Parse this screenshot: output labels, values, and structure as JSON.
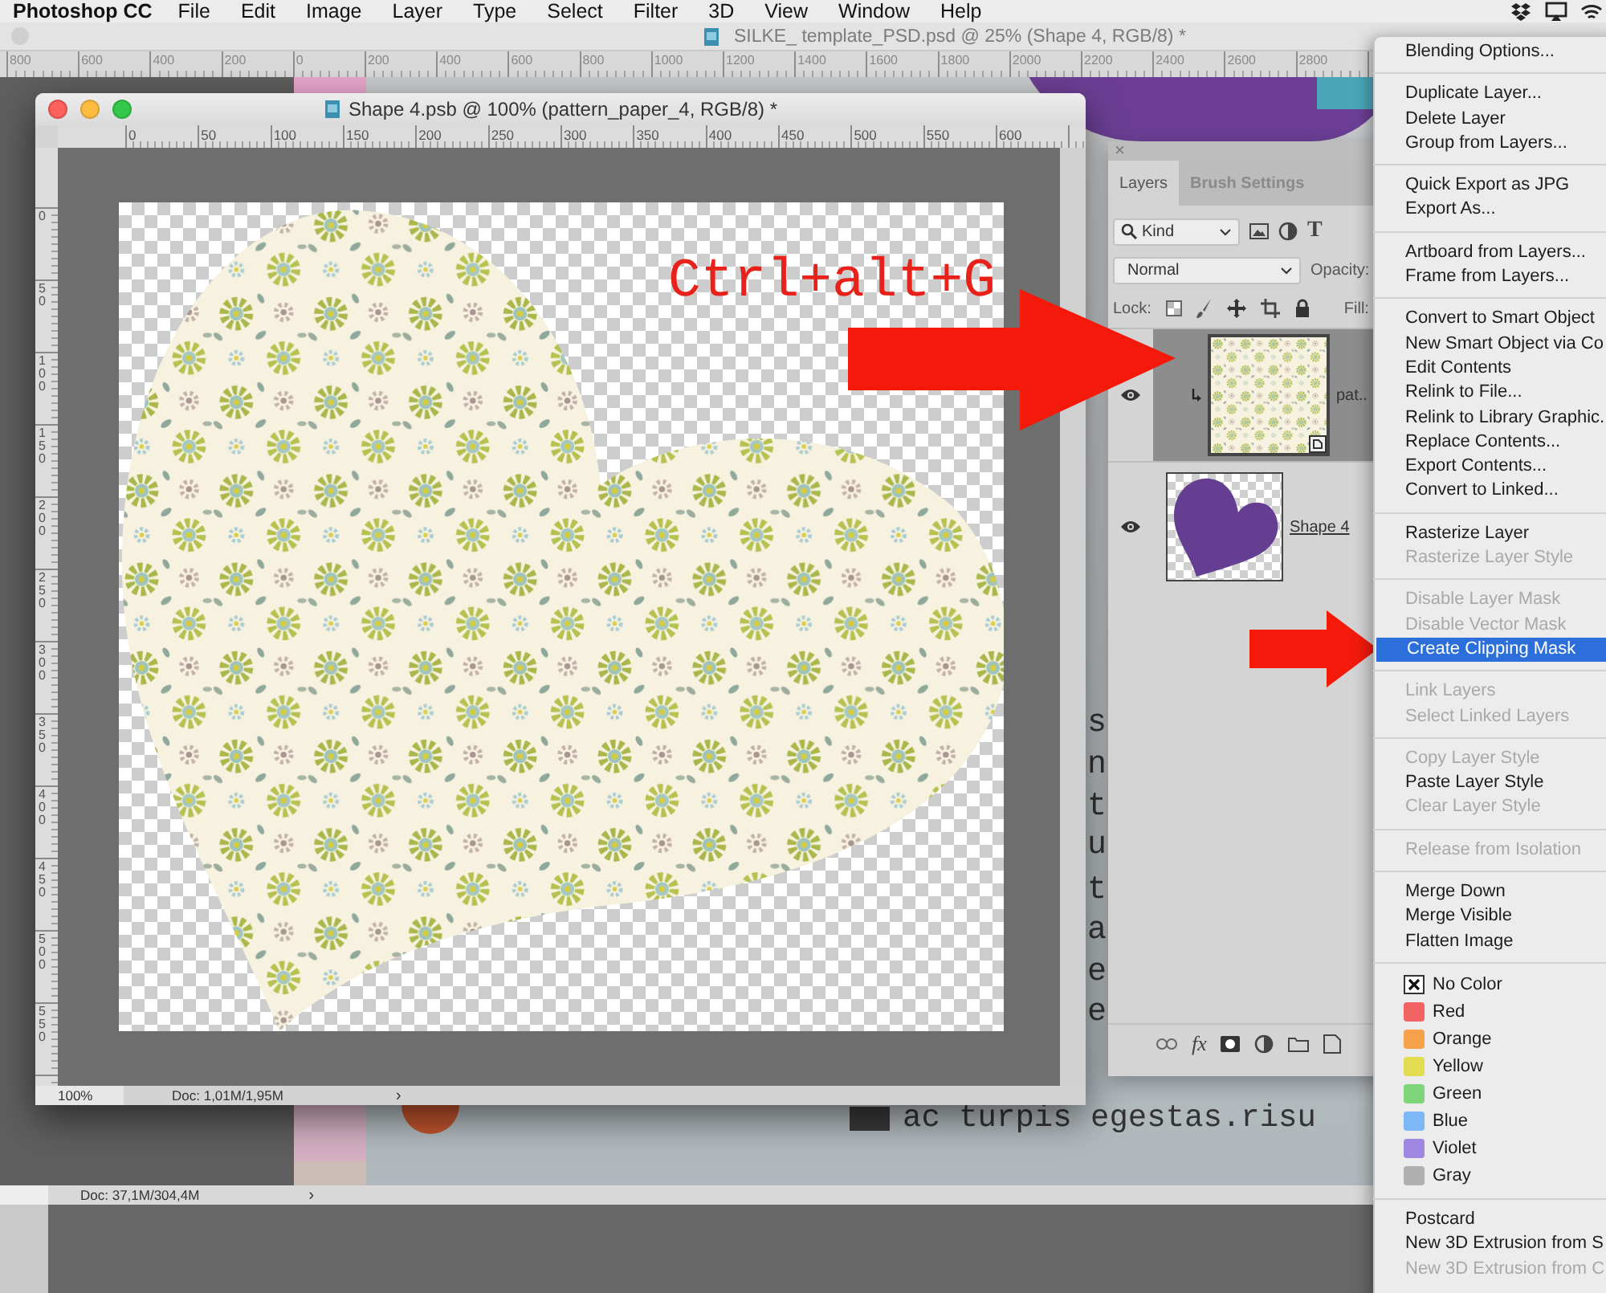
{
  "menu_bar": {
    "app": "Photoshop CC",
    "items": [
      "File",
      "Edit",
      "Image",
      "Layer",
      "Type",
      "Select",
      "Filter",
      "3D",
      "View",
      "Window",
      "Help"
    ]
  },
  "main_document": {
    "title": "SILKE_ template_PSD.psd @ 25% (Shape 4, RGB/8) *",
    "ruler_labels": [
      "800",
      "600",
      "400",
      "200",
      "0",
      "200",
      "400",
      "600",
      "800",
      "1000",
      "1200",
      "1400",
      "1600",
      "1800",
      "2000",
      "2200",
      "2400",
      "2600",
      "2800"
    ],
    "canvas_letters": [
      "s",
      "n",
      "t",
      "u",
      "t",
      "a",
      "e",
      "e"
    ],
    "canvas_line": "ac turpis egestas.risu",
    "status": "Doc: 37,1M/304,4M",
    "status_arrow": "›"
  },
  "document_window": {
    "title": "Shape 4.psb @ 100% (pattern_paper_4, RGB/8) *",
    "ruler_labels": [
      "0",
      "50",
      "100",
      "150",
      "200",
      "250",
      "300",
      "350",
      "400",
      "450",
      "500",
      "550",
      "600"
    ],
    "vertical_ruler_labels": [
      "0",
      "50",
      "100",
      "150",
      "200",
      "250",
      "300",
      "350",
      "400",
      "450",
      "500",
      "550"
    ],
    "zoom": "100%",
    "status": "Doc: 1,01M/1,95M",
    "status_arrow": "›"
  },
  "annotation": {
    "text": "Ctrl+alt+G"
  },
  "layers_panel": {
    "close": "×",
    "tabs": [
      {
        "label": "Layers",
        "selected": true
      },
      {
        "label": "Brush Settings",
        "selected": false
      }
    ],
    "filter": "Kind",
    "type_filter": "T",
    "blend_mode": "Normal",
    "opacity_label": "Opacity:",
    "lock_label": "Lock:",
    "fill_label": "Fill:",
    "layers": [
      {
        "name": "pat..",
        "kind": "pattern",
        "selected": true,
        "visible": true,
        "clipped": true
      },
      {
        "name": "Shape 4",
        "kind": "shape",
        "selected": false,
        "visible": true,
        "clipped": false
      }
    ],
    "fx": "fx"
  },
  "context_menu": {
    "sections": [
      {
        "kind": "commands",
        "items": [
          {
            "label": "Blending Options...",
            "disabled": false,
            "selected": false
          }
        ]
      },
      {
        "kind": "commands",
        "items": [
          {
            "label": "Duplicate Layer...",
            "disabled": false,
            "selected": false
          },
          {
            "label": "Delete Layer",
            "disabled": false,
            "selected": false
          },
          {
            "label": "Group from Layers...",
            "disabled": false,
            "selected": false
          }
        ]
      },
      {
        "kind": "commands",
        "items": [
          {
            "label": "Quick Export as JPG",
            "disabled": false,
            "selected": false
          },
          {
            "label": "Export As...",
            "disabled": false,
            "selected": false
          }
        ]
      },
      {
        "kind": "commands",
        "items": [
          {
            "label": "Artboard from Layers...",
            "disabled": false,
            "selected": false
          },
          {
            "label": "Frame from Layers...",
            "disabled": false,
            "selected": false
          }
        ]
      },
      {
        "kind": "commands",
        "items": [
          {
            "label": "Convert to Smart Object",
            "disabled": false,
            "selected": false
          },
          {
            "label": "New Smart Object via Co",
            "disabled": false,
            "selected": false
          },
          {
            "label": "Edit Contents",
            "disabled": false,
            "selected": false
          },
          {
            "label": "Relink to File...",
            "disabled": false,
            "selected": false
          },
          {
            "label": "Relink to Library Graphic.",
            "disabled": false,
            "selected": false
          },
          {
            "label": "Replace Contents...",
            "disabled": false,
            "selected": false
          },
          {
            "label": "Export Contents...",
            "disabled": false,
            "selected": false
          },
          {
            "label": "Convert to Linked...",
            "disabled": false,
            "selected": false
          }
        ]
      },
      {
        "kind": "commands",
        "items": [
          {
            "label": "Rasterize Layer",
            "disabled": false,
            "selected": false
          },
          {
            "label": "Rasterize Layer Style",
            "disabled": true,
            "selected": false
          }
        ]
      },
      {
        "kind": "commands",
        "items": [
          {
            "label": "Disable Layer Mask",
            "disabled": true,
            "selected": false
          },
          {
            "label": "Disable Vector Mask",
            "disabled": true,
            "selected": false
          },
          {
            "label": "Create Clipping Mask",
            "disabled": false,
            "selected": true
          }
        ]
      },
      {
        "kind": "commands",
        "items": [
          {
            "label": "Link Layers",
            "disabled": true,
            "selected": false
          },
          {
            "label": "Select Linked Layers",
            "disabled": true,
            "selected": false
          }
        ]
      },
      {
        "kind": "commands",
        "items": [
          {
            "label": "Copy Layer Style",
            "disabled": true,
            "selected": false
          },
          {
            "label": "Paste Layer Style",
            "disabled": false,
            "selected": false
          },
          {
            "label": "Clear Layer Style",
            "disabled": true,
            "selected": false
          }
        ]
      },
      {
        "kind": "commands",
        "items": [
          {
            "label": "Release from Isolation",
            "disabled": true,
            "selected": false
          }
        ]
      },
      {
        "kind": "commands",
        "items": [
          {
            "label": "Merge Down",
            "disabled": false,
            "selected": false
          },
          {
            "label": "Merge Visible",
            "disabled": false,
            "selected": false
          },
          {
            "label": "Flatten Image",
            "disabled": false,
            "selected": false
          }
        ]
      },
      {
        "kind": "colors",
        "items": [
          {
            "label": "No Color",
            "kind": "none"
          },
          {
            "label": "Red",
            "kind": "swatch",
            "color": "#f26464"
          },
          {
            "label": "Orange",
            "kind": "swatch",
            "color": "#f5a24a"
          },
          {
            "label": "Yellow",
            "kind": "swatch",
            "color": "#e3dc50"
          },
          {
            "label": "Green",
            "kind": "swatch",
            "color": "#7fd67a"
          },
          {
            "label": "Blue",
            "kind": "swatch",
            "color": "#7db7f5"
          },
          {
            "label": "Violet",
            "kind": "swatch",
            "color": "#9f86e0"
          },
          {
            "label": "Gray",
            "kind": "swatch",
            "color": "#b0b0b0"
          }
        ]
      },
      {
        "kind": "commands",
        "items": [
          {
            "label": "Postcard",
            "disabled": false,
            "selected": false
          },
          {
            "label": "New 3D Extrusion from S",
            "disabled": false,
            "selected": false
          },
          {
            "label": "New 3D Extrusion from C",
            "disabled": true,
            "selected": false
          }
        ]
      }
    ]
  }
}
